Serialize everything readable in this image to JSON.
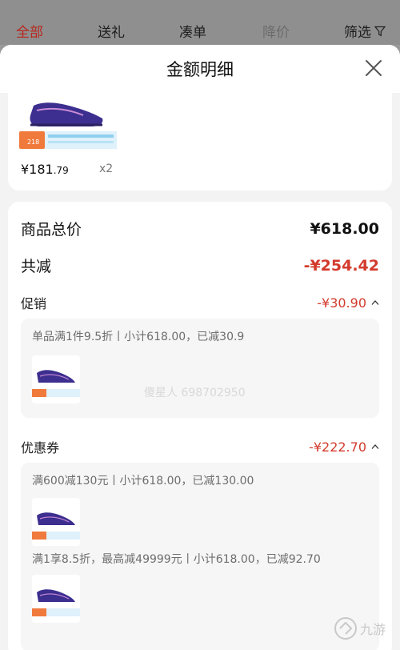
{
  "tabs": {
    "all": "全部",
    "gift": "送礼",
    "combine": "凑单",
    "price_drop": "降价",
    "filter": "筛选"
  },
  "sheet": {
    "title": "金额明细"
  },
  "product": {
    "price_int": "¥181",
    "price_dec": ".79",
    "qty": "x2",
    "tag_label": "218"
  },
  "details": {
    "total_label": "商品总价",
    "total_value": "¥618.00",
    "reduce_label": "共减",
    "reduce_value": "-¥254.42",
    "promo": {
      "label": "促销",
      "value": "-¥30.90",
      "line": "单品满1件9.5折丨小计618.00，已减30.9",
      "watermark": "傻星人 698702950"
    },
    "coupon": {
      "label": "优惠券",
      "value": "-¥222.70",
      "line1": "满600减130元丨小计618.00，已减130.00",
      "line2": "满1享8.5折，最高减49999元丨小计618.00，已减92.70"
    }
  },
  "brand": "九游",
  "colors": {
    "accent_red": "#d23a2c",
    "active_tab": "#b8261c"
  }
}
